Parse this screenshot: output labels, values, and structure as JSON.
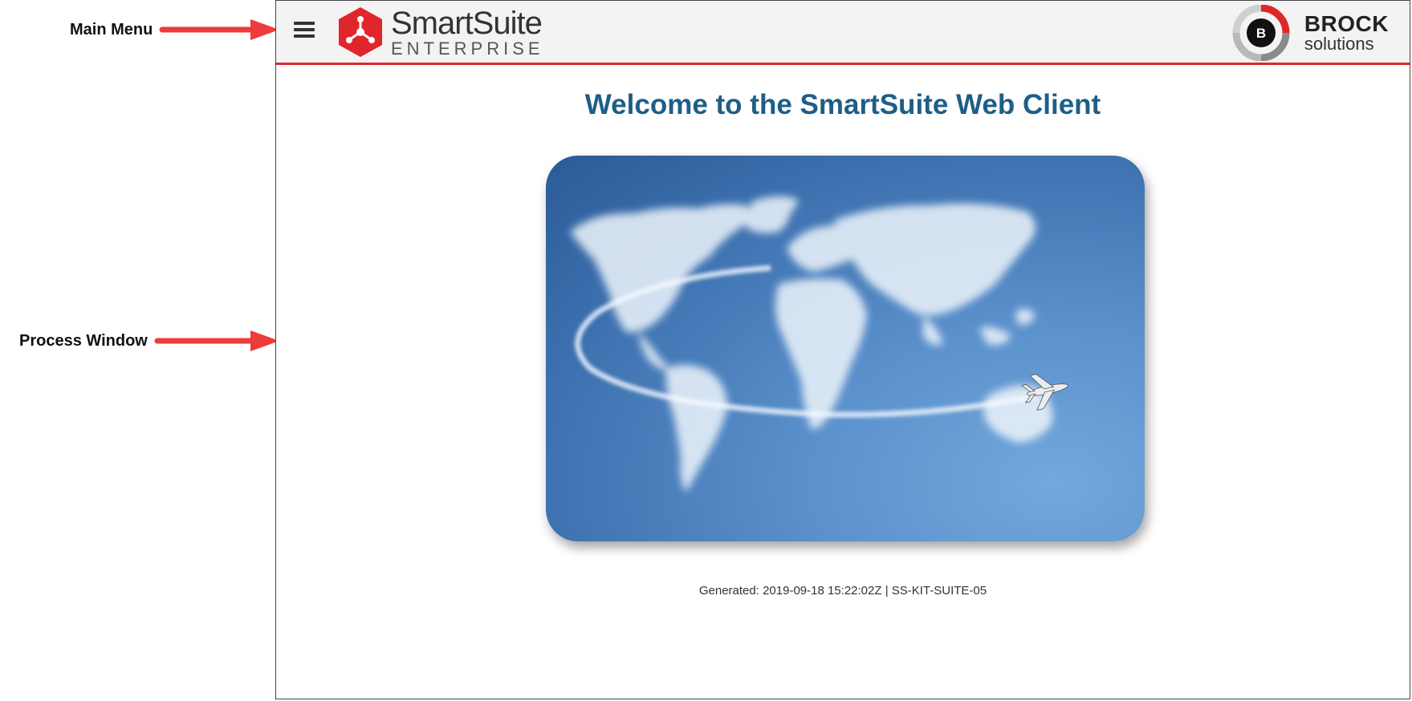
{
  "annotations": {
    "main_menu": "Main Menu",
    "process_window": "Process Window"
  },
  "header": {
    "brand_name": "SmartSuite",
    "brand_sub": "ENTERPRISE",
    "partner_name": "BROCK",
    "partner_sub": "solutions",
    "partner_badge": "B"
  },
  "main": {
    "welcome_title": "Welcome to the SmartSuite Web Client",
    "generated": "Generated: 2019-09-18 15:22:02Z | SS-KIT-SUITE-05"
  },
  "colors": {
    "accent_red": "#e0262b",
    "title_blue": "#1e5e87",
    "header_bg": "#f3f3f3"
  },
  "icons": {
    "menu": "hamburger-menu-icon",
    "brand": "smartsuite-logo-icon",
    "partner": "brock-logo-icon",
    "arrow": "arrow-right-icon"
  }
}
